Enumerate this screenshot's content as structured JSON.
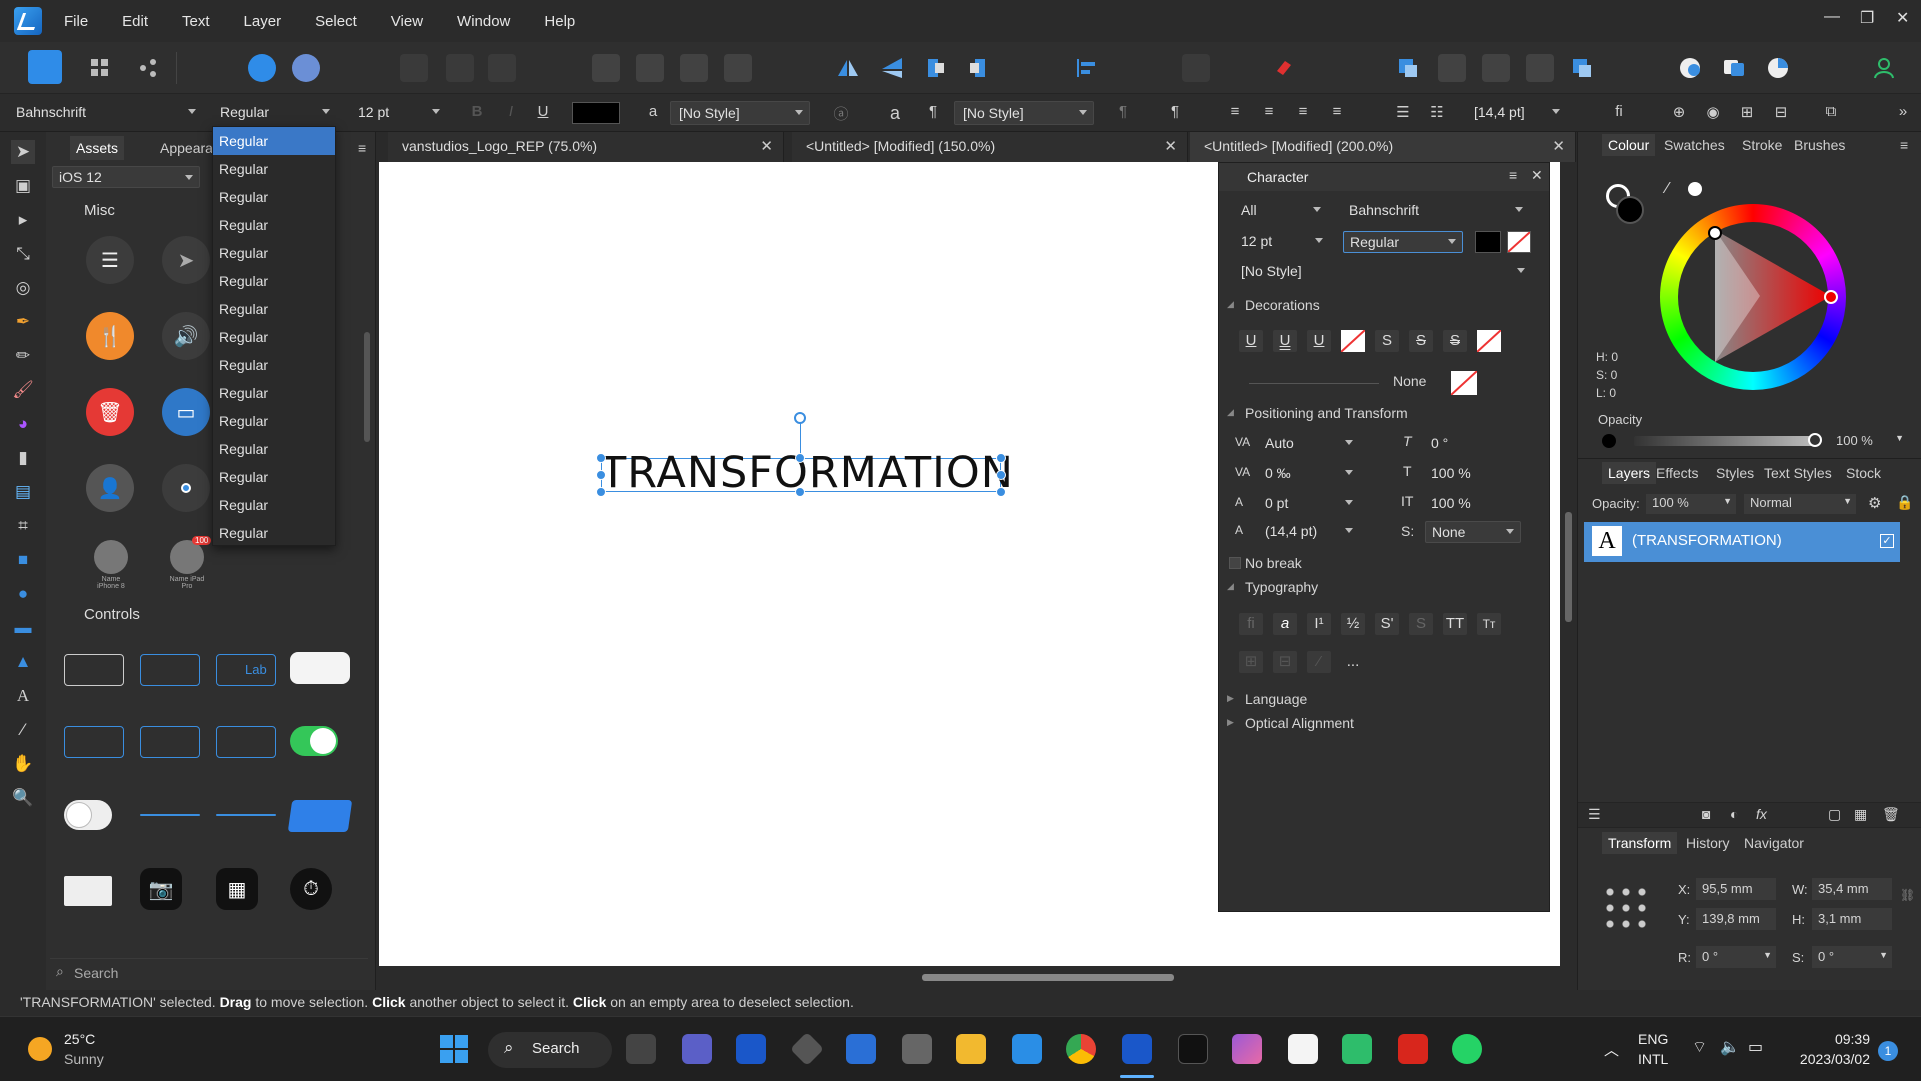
{
  "menu": {
    "items": [
      "File",
      "Edit",
      "Text",
      "Layer",
      "Select",
      "View",
      "Window",
      "Help"
    ]
  },
  "context_bar": {
    "font_family": "Bahnschrift",
    "font_style": "Regular",
    "font_size": "12 pt",
    "char_style": "[No Style]",
    "para_style": "[No Style]",
    "leading": "[14,4 pt]",
    "underline_glyph": "U",
    "a_glyph": "a",
    "pilcrow_glyph": "¶",
    "fi_glyph": "fi"
  },
  "style_dropdown": {
    "items": [
      "Regular",
      "Regular",
      "Regular",
      "Regular",
      "Regular",
      "Regular",
      "Regular",
      "Regular",
      "Regular",
      "Regular",
      "Regular",
      "Regular",
      "Regular",
      "Regular",
      "Regular"
    ]
  },
  "assets_panel": {
    "tabs": [
      "Assets",
      "Appearance"
    ],
    "category": "iOS 12",
    "section_misc": "Misc",
    "section_controls": "Controls",
    "label_iphone": "Name iPhone 8",
    "label_ipad": "Name iPad Pro",
    "badge_count": "100",
    "control_label": "Lab",
    "search_placeholder": "Search"
  },
  "document_tabs": [
    {
      "title": "vanstudios_Logo_REP (75.0%)"
    },
    {
      "title": "<Untitled> [Modified] (150.0%)"
    },
    {
      "title": "<Untitled> [Modified] (200.0%)"
    }
  ],
  "canvas": {
    "text": "TRANSFORMATION"
  },
  "character_panel": {
    "title": "Character",
    "scope": "All",
    "font": "Bahnschrift",
    "size": "12 pt",
    "style": "Regular",
    "char_style": "[No Style]",
    "decorations_label": "Decorations",
    "decoration_glyphs": [
      "U",
      "U",
      "U",
      "S",
      "S",
      "S"
    ],
    "line_none": "None",
    "positioning_label": "Positioning and Transform",
    "kerning": "Auto",
    "shear": "0 °",
    "tracking": "0 ‰",
    "vertical_scale": "100 %",
    "baseline": "0 pt",
    "horizontal_scale": "100 %",
    "leading": "(14,4 pt)",
    "s_label": "S:",
    "s_value": "None",
    "no_break": "No break",
    "typography_label": "Typography",
    "typo_glyphs": [
      "fi",
      "a",
      "I¹",
      "½",
      "S'",
      "S",
      "TT",
      "Tт"
    ],
    "more": "...",
    "language_label": "Language",
    "optical_label": "Optical Alignment"
  },
  "colour_panel": {
    "tabs": [
      "Colour",
      "Swatches",
      "Stroke",
      "Brushes"
    ],
    "h": "H: 0",
    "s": "S: 0",
    "l": "L: 0",
    "opacity_label": "Opacity",
    "opacity_value": "100 %"
  },
  "layers_panel": {
    "tabs": [
      "Layers",
      "Effects",
      "Styles",
      "Text Styles",
      "Stock"
    ],
    "opacity_label": "Opacity:",
    "opacity_value": "100 %",
    "blend_mode": "Normal",
    "layer_name": "(TRANSFORMATION)",
    "layer_icon": "A"
  },
  "transform_panel": {
    "tabs": [
      "Transform",
      "History",
      "Navigator"
    ],
    "x_label": "X:",
    "x": "95,5 mm",
    "w_label": "W:",
    "w": "35,4 mm",
    "y_label": "Y:",
    "y": "139,8 mm",
    "h_label": "H:",
    "h": "3,1 mm",
    "r_label": "R:",
    "r": "0 °",
    "s_label": "S:",
    "s": "0 °"
  },
  "status": {
    "part1": "'TRANSFORMATION' selected. ",
    "drag": "Drag",
    "part2": " to move selection. ",
    "click1": "Click",
    "part3": " another object to select it. ",
    "click2": "Click",
    "part4": " on an empty area to deselect selection."
  },
  "taskbar": {
    "weather_temp": "25°C",
    "weather_desc": "Sunny",
    "search_label": "Search",
    "lang1": "ENG",
    "lang2": "INTL",
    "time": "09:39",
    "date": "2023/03/02",
    "notif_count": "1"
  },
  "colors": {
    "accent": "#2f8ce8",
    "selection": "#3a78c7",
    "layer_highlight": "#4a8fd6"
  }
}
